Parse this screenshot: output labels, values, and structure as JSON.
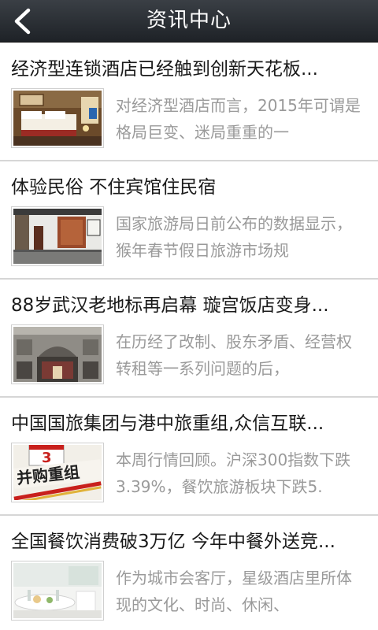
{
  "header": {
    "title": "资讯中心",
    "back_icon": "back-chevron-icon"
  },
  "news": [
    {
      "title": "经济型连锁酒店已经触到创新天花板...",
      "desc": "对经济型酒店而言，2015年可谓是格局巨变、迷局重重的一",
      "thumb_icon": "hotel-room-thumbnail"
    },
    {
      "title": "体验民俗 不住宾馆住民宿",
      "desc": "国家旅游局日前公布的数据显示，猴年春节假日旅游市场规",
      "thumb_icon": "guesthouse-thumbnail"
    },
    {
      "title": "88岁武汉老地标再启幕 璇宫饭店变身...",
      "desc": "在历经了改制、股东矛盾、经营权转租等一系列问题的后，",
      "thumb_icon": "historic-building-thumbnail"
    },
    {
      "title": "中国国旅集团与港中旅重组,众信互联...",
      "desc": "本周行情回顾。沪深300指数下跌3.39%，餐饮旅游板块下跌5.",
      "thumb_icon": "merger-calendar-thumbnail"
    },
    {
      "title": "全国餐饮消费破3万亿 今年中餐外送竞...",
      "desc": "作为城市会客厅，星级酒店里所体现的文化、时尚、休闲、",
      "thumb_icon": "dining-table-thumbnail"
    }
  ],
  "thumb_text": {
    "merger_badge": "并购重组",
    "calendar_number": "3"
  }
}
